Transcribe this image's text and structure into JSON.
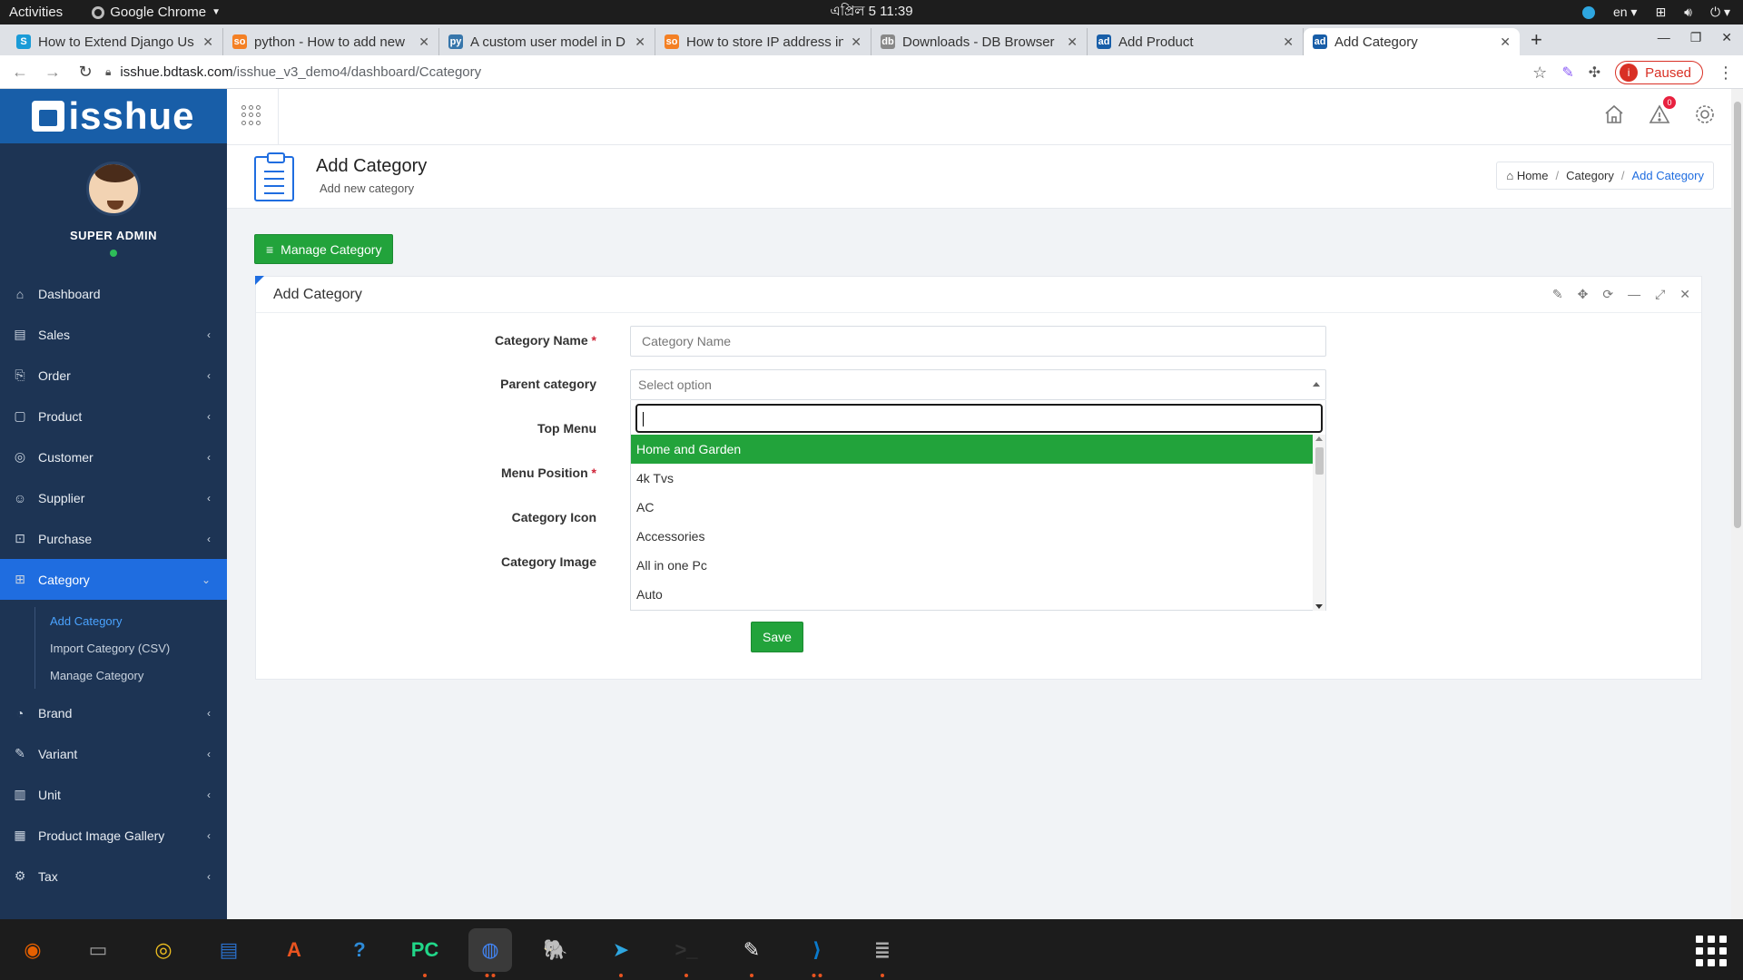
{
  "topbar": {
    "activities": "Activities",
    "app_name": "Google Chrome",
    "clock": "এপ্রিল 5  11:39",
    "lang": "en"
  },
  "tabs": [
    {
      "title": "How to Extend Django Us",
      "favicon": "S",
      "color": "#1a9bd7"
    },
    {
      "title": "python - How to add new",
      "favicon": "so",
      "color": "#f48024"
    },
    {
      "title": "A custom user model in D",
      "favicon": "py",
      "color": "#3776ab"
    },
    {
      "title": "How to store IP address in",
      "favicon": "so",
      "color": "#f48024"
    },
    {
      "title": "Downloads - DB Browser",
      "favicon": "db",
      "color": "#888888"
    },
    {
      "title": "Add Product",
      "favicon": "ad",
      "color": "#185ea8"
    },
    {
      "title": "Add Category",
      "favicon": "ad",
      "color": "#185ea8",
      "active": true
    }
  ],
  "address": {
    "host": "isshue.bdtask.com",
    "path": "/isshue_v3_demo4/dashboard/Ccategory",
    "profile_status": "Paused",
    "profile_initial": "i"
  },
  "sidebar": {
    "logo": "isshue",
    "role": "SUPER ADMIN",
    "items": [
      {
        "label": "Dashboard",
        "icon": "home-icon",
        "glyph": "⌂",
        "caret": ""
      },
      {
        "label": "Sales",
        "icon": "sales-icon",
        "glyph": "▤",
        "caret": "‹"
      },
      {
        "label": "Order",
        "icon": "order-icon",
        "glyph": "⎘",
        "caret": "‹"
      },
      {
        "label": "Product",
        "icon": "product-icon",
        "glyph": "▢",
        "caret": "‹"
      },
      {
        "label": "Customer",
        "icon": "customer-icon",
        "glyph": "◎",
        "caret": "‹"
      },
      {
        "label": "Supplier",
        "icon": "supplier-icon",
        "glyph": "☺",
        "caret": "‹"
      },
      {
        "label": "Purchase",
        "icon": "purchase-icon",
        "glyph": "⊡",
        "caret": "‹"
      },
      {
        "label": "Category",
        "icon": "category-icon",
        "glyph": "⊞",
        "caret": "⌄"
      }
    ],
    "sub_items": [
      "Add Category",
      "Import Category (CSV)",
      "Manage Category"
    ],
    "items_after": [
      {
        "label": "Brand",
        "icon": "brand-icon",
        "glyph": "◔",
        "caret": "‹"
      },
      {
        "label": "Variant",
        "icon": "variant-icon",
        "glyph": "✎",
        "caret": "‹"
      },
      {
        "label": "Unit",
        "icon": "unit-icon",
        "glyph": "▥",
        "caret": "‹"
      },
      {
        "label": "Product Image Gallery",
        "icon": "gallery-icon",
        "glyph": "▦",
        "caret": "‹"
      },
      {
        "label": "Tax",
        "icon": "tax-icon",
        "glyph": "⚙",
        "caret": "‹"
      }
    ]
  },
  "header": {
    "notification_count": "0"
  },
  "title": {
    "heading": "Add Category",
    "subheading": "Add new category",
    "breadcrumb": [
      "Home",
      "Category",
      "Add Category"
    ]
  },
  "manage_button": "Manage Category",
  "panel": {
    "title": "Add Category",
    "fields": {
      "category_name": {
        "label": "Category Name",
        "placeholder": "Category Name"
      },
      "parent_category": {
        "label": "Parent category",
        "value": "Select option"
      },
      "top_menu": {
        "label": "Top Menu"
      },
      "menu_position": {
        "label": "Menu Position"
      },
      "category_icon": {
        "label": "Category Icon"
      },
      "category_image": {
        "label": "Category Image"
      }
    },
    "required_mark": "*",
    "dropdown_options": [
      "Home and Garden",
      "4k Tvs",
      "AC",
      "Accessories",
      "All in one Pc",
      "Auto"
    ],
    "save_label": "Save"
  },
  "dock": [
    {
      "name": "firefox-icon",
      "color": "#e66000",
      "glyph": "◉"
    },
    {
      "name": "files-icon",
      "color": "#9a9a9a",
      "glyph": "▭"
    },
    {
      "name": "rhythmbox-icon",
      "color": "#f0c020",
      "glyph": "◎"
    },
    {
      "name": "writer-icon",
      "color": "#2a6fc9",
      "glyph": "▤"
    },
    {
      "name": "software-icon",
      "color": "#e95420",
      "glyph": "A"
    },
    {
      "name": "help-icon",
      "color": "#2e8bd8",
      "glyph": "?"
    },
    {
      "name": "pycharm-icon",
      "color": "#21d789",
      "glyph": "PC"
    },
    {
      "name": "chrome-icon",
      "color": "#4285f4",
      "glyph": "◍"
    },
    {
      "name": "pgadmin-icon",
      "color": "#336791",
      "glyph": "🐘"
    },
    {
      "name": "telegram-icon",
      "color": "#2ea6e0",
      "glyph": "➤"
    },
    {
      "name": "terminal-icon",
      "color": "#333333",
      "glyph": ">_"
    },
    {
      "name": "text-editor-icon",
      "color": "#eeeeee",
      "glyph": "✎"
    },
    {
      "name": "vscode-icon",
      "color": "#0a7acc",
      "glyph": "⟩"
    },
    {
      "name": "db-browser-icon",
      "color": "#aaaaaa",
      "glyph": "≣"
    }
  ]
}
